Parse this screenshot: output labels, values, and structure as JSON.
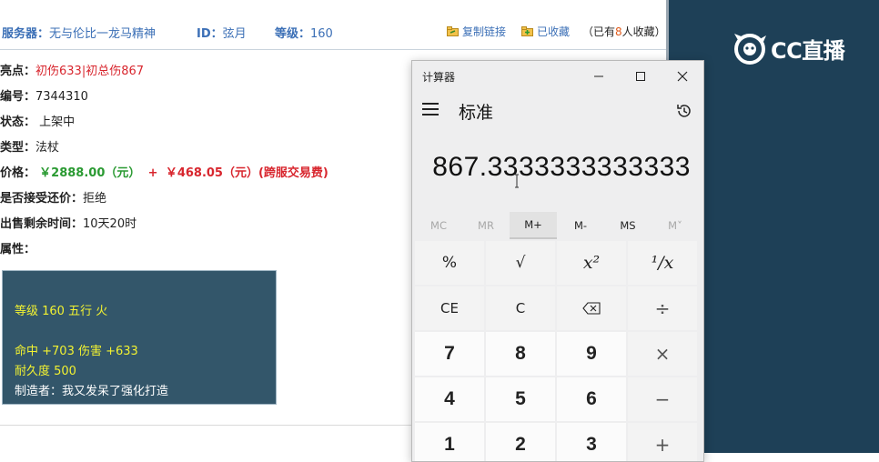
{
  "info_bar": {
    "server_label": "服务器：",
    "server_value": "无与伦比一龙马精神",
    "id_label": "ID：",
    "id_value": "弦月",
    "level_label": "等级：",
    "level_value": "160",
    "copy_link": "复制链接",
    "favorited": "已收藏",
    "fav_note_prefix": "（已有",
    "fav_count": "8",
    "fav_note_suffix": "人收藏）"
  },
  "details": {
    "highlight_label": "亮点：",
    "highlight_value": "初伤633|初总伤867",
    "number_label": "编号：",
    "number_value": "7344310",
    "status_label": "状态：",
    "status_value": "上架中",
    "type_label": "类型：",
    "type_value": "法杖",
    "price_label": "价格：",
    "price_main": "￥2888.00（元）",
    "price_plus": "+",
    "price_fee": "￥468.05（元）(跨服交易费)",
    "bargain_label": "是否接受还价：",
    "bargain_value": "拒绝",
    "time_label": "出售剩余时间：",
    "time_value": "10天20时",
    "attr_label": "属性："
  },
  "attributes": {
    "line1": "等级 160 五行 火",
    "line2": "命中 +703 伤害 +633",
    "line3": "耐久度 500",
    "line4": "制造者：我又发呆了强化打造"
  },
  "calculator": {
    "title": "计算器",
    "mode": "标准",
    "display": "867.3333333333333",
    "memory": [
      "MC",
      "MR",
      "M+",
      "M-",
      "MS",
      "M˅"
    ],
    "keys": [
      [
        "%",
        "√",
        "x²",
        "¹/x"
      ],
      [
        "CE",
        "C",
        "⌫",
        "÷"
      ],
      [
        "7",
        "8",
        "9",
        "×"
      ],
      [
        "4",
        "5",
        "6",
        "−"
      ],
      [
        "1",
        "2",
        "3",
        "+"
      ]
    ]
  },
  "cc_panel": {
    "logo_text": "CC直播"
  },
  "colors": {
    "link_blue": "#3b6fb6",
    "price_green": "#2a9a32",
    "highlight_red": "#d8262e",
    "panel_navy": "#1e4057",
    "attr_box": "#33566a"
  }
}
